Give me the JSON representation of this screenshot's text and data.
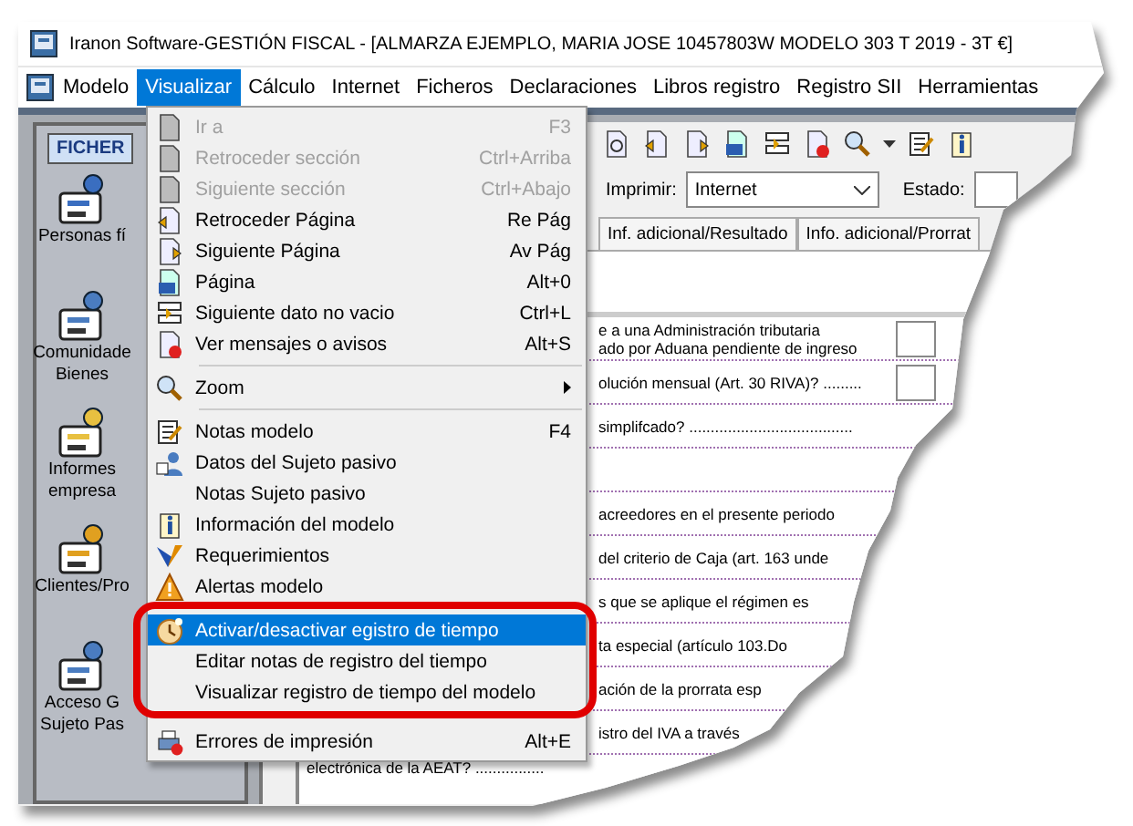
{
  "window": {
    "title": "Iranon Software-GESTIÓN FISCAL - [ALMARZA EJEMPLO, MARIA JOSE 10457803W  MODELO 303 T  2019 - 3T €]"
  },
  "menubar": [
    {
      "label": "Modelo",
      "selected": false
    },
    {
      "label": "Visualizar",
      "selected": true
    },
    {
      "label": "Cálculo",
      "selected": false
    },
    {
      "label": "Internet",
      "selected": false
    },
    {
      "label": "Ficheros",
      "selected": false
    },
    {
      "label": "Declaraciones",
      "selected": false
    },
    {
      "label": "Libros registro",
      "selected": false
    },
    {
      "label": "Registro SII",
      "selected": false
    },
    {
      "label": "Herramientas",
      "selected": false
    }
  ],
  "sidebar": {
    "tab": "FICHER",
    "items": [
      {
        "lines": [
          "Personas fí"
        ]
      },
      {
        "lines": [
          "Comunidade",
          "Bienes"
        ]
      },
      {
        "lines": [
          "Informes",
          "empresa"
        ]
      },
      {
        "lines": [
          "Clientes/Pro"
        ]
      },
      {
        "lines": [
          "Acceso G",
          "Sujeto Pas"
        ]
      }
    ]
  },
  "print_row": {
    "label": "Imprimir:",
    "value": "Internet",
    "status_label": "Estado:"
  },
  "tabs": [
    "Inf. adicional/Resultado",
    "Info. adicional/Prorrat"
  ],
  "rows": [
    {
      "kind": "partial",
      "lines": [
        "e a una Administración tributaria",
        "ado por Aduana pendiente de ingreso"
      ],
      "field": true
    },
    {
      "kind": "partial",
      "lines": [
        "olución mensual (Art. 30 RIVA)? ........."
      ],
      "field": true
    },
    {
      "kind": "partial",
      "lines": [
        "simplifcado? ......................................"
      ],
      "field": false
    },
    {
      "kind": "blank"
    },
    {
      "kind": "partial",
      "lines": [
        "acreedores en el presente periodo"
      ],
      "field": false
    },
    {
      "kind": "partial",
      "lines": [
        "del criterio de Caja (art. 163 unde"
      ],
      "field": false
    },
    {
      "kind": "partial",
      "lines": [
        "s que se aplique el régimen es"
      ],
      "field": false
    },
    {
      "kind": "partial",
      "lines": [
        "ta especial (artículo 103.Do"
      ],
      "field": false
    },
    {
      "kind": "partial",
      "lines": [
        "ación de la prorrata esp"
      ],
      "field": false
    },
    {
      "kind": "partial",
      "lines": [
        "istro del IVA a través"
      ],
      "field": false
    },
    {
      "kind": "full",
      "lines": [
        "electrónica de la AEAT? ................"
      ],
      "field": false
    }
  ],
  "menu": [
    {
      "kind": "item",
      "label": "Ir a",
      "shortcut": "F3",
      "disabled": true,
      "selected": false
    },
    {
      "kind": "item",
      "label": "Retroceder sección",
      "shortcut": "Ctrl+Arriba",
      "disabled": true,
      "selected": false
    },
    {
      "kind": "item",
      "label": "Siguiente sección",
      "shortcut": "Ctrl+Abajo",
      "disabled": true,
      "selected": false
    },
    {
      "kind": "item",
      "label": "Retroceder Página",
      "shortcut": "Re Pág",
      "disabled": false,
      "selected": false
    },
    {
      "kind": "item",
      "label": "Siguiente Página",
      "shortcut": "Av Pág",
      "disabled": false,
      "selected": false
    },
    {
      "kind": "item",
      "label": "Página",
      "shortcut": "Alt+0",
      "disabled": false,
      "selected": false
    },
    {
      "kind": "item",
      "label": "Siguiente dato no vacio",
      "shortcut": "Ctrl+L",
      "disabled": false,
      "selected": false
    },
    {
      "kind": "item",
      "label": "Ver mensajes o avisos",
      "shortcut": "Alt+S",
      "disabled": false,
      "selected": false
    },
    {
      "kind": "separator"
    },
    {
      "kind": "submenu",
      "label": "Zoom",
      "disabled": false,
      "selected": false
    },
    {
      "kind": "separator"
    },
    {
      "kind": "item",
      "label": "Notas modelo",
      "shortcut": "F4",
      "disabled": false,
      "selected": false
    },
    {
      "kind": "item",
      "label": "Datos del Sujeto pasivo",
      "disabled": false,
      "selected": false
    },
    {
      "kind": "item",
      "label": "Notas Sujeto pasivo",
      "disabled": false,
      "selected": false
    },
    {
      "kind": "item",
      "label": "Información del modelo",
      "disabled": false,
      "selected": false
    },
    {
      "kind": "item",
      "label": "Requerimientos",
      "disabled": false,
      "selected": false
    },
    {
      "kind": "item",
      "label": "Alertas modelo",
      "disabled": false,
      "selected": false
    },
    {
      "kind": "separator"
    },
    {
      "kind": "item",
      "label": "Activar/desactivar egistro de tiempo",
      "disabled": false,
      "selected": true
    },
    {
      "kind": "item",
      "label": "Editar notas de registro del tiempo",
      "disabled": false,
      "selected": false
    },
    {
      "kind": "item",
      "label": "Visualizar registro de tiempo del modelo",
      "disabled": false,
      "selected": false
    },
    {
      "kind": "separator"
    },
    {
      "kind": "item",
      "label": "Errores de impresión",
      "shortcut": "Alt+E",
      "disabled": false,
      "selected": false
    }
  ]
}
